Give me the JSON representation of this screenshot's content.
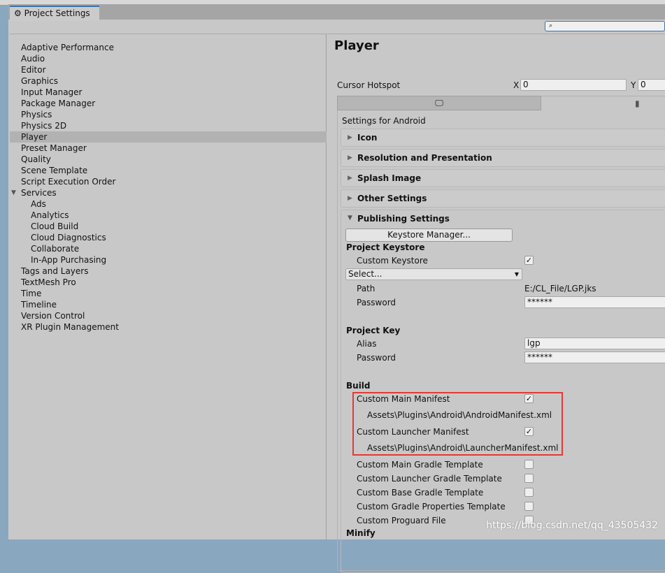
{
  "window": {
    "tab_title": "Project Settings",
    "search_placeholder": ""
  },
  "sidebar": {
    "items": [
      {
        "label": "Adaptive Performance"
      },
      {
        "label": "Audio"
      },
      {
        "label": "Editor"
      },
      {
        "label": "Graphics"
      },
      {
        "label": "Input Manager"
      },
      {
        "label": "Package Manager"
      },
      {
        "label": "Physics"
      },
      {
        "label": "Physics 2D"
      },
      {
        "label": "Player",
        "selected": true
      },
      {
        "label": "Preset Manager"
      },
      {
        "label": "Quality"
      },
      {
        "label": "Scene Template"
      },
      {
        "label": "Script Execution Order"
      },
      {
        "label": "Services",
        "expanded": true
      },
      {
        "label": "Ads",
        "sub": true
      },
      {
        "label": "Analytics",
        "sub": true
      },
      {
        "label": "Cloud Build",
        "sub": true
      },
      {
        "label": "Cloud Diagnostics",
        "sub": true
      },
      {
        "label": "Collaborate",
        "sub": true
      },
      {
        "label": "In-App Purchasing",
        "sub": true
      },
      {
        "label": "Tags and Layers"
      },
      {
        "label": "TextMesh Pro"
      },
      {
        "label": "Time"
      },
      {
        "label": "Timeline"
      },
      {
        "label": "Version Control"
      },
      {
        "label": "XR Plugin Management"
      }
    ]
  },
  "main": {
    "title": "Player",
    "cursor_hotspot": {
      "label": "Cursor Hotspot",
      "x_label": "X",
      "x": "0",
      "y_label": "Y",
      "y": "0"
    },
    "platform_tabs": [
      {
        "icon": "monitor-icon"
      },
      {
        "icon": "android-icon",
        "active": true
      }
    ],
    "settings_for": "Settings for Android",
    "sections": [
      "Icon",
      "Resolution and Presentation",
      "Splash Image",
      "Other Settings"
    ],
    "publishing": {
      "title": "Publishing Settings",
      "keystore_manager": "Keystore Manager...",
      "project_keystore": "Project Keystore",
      "custom_keystore": "Custom Keystore",
      "custom_keystore_checked": true,
      "select": "Select...",
      "path_label": "Path",
      "path": "E:/CL_File/LGP.jks",
      "password_label": "Password",
      "password": "******",
      "project_key": "Project Key",
      "alias_label": "Alias",
      "alias": "lgp",
      "key_password_label": "Password",
      "key_password": "******",
      "build": "Build",
      "build_items": [
        {
          "label": "Custom Main Manifest",
          "checked": true,
          "path": "Assets\\Plugins\\Android\\AndroidManifest.xml"
        },
        {
          "label": "Custom Launcher Manifest",
          "checked": true,
          "path": "Assets\\Plugins\\Android\\LauncherManifest.xml"
        },
        {
          "label": "Custom Main Gradle Template",
          "checked": false
        },
        {
          "label": "Custom Launcher Gradle Template",
          "checked": false
        },
        {
          "label": "Custom Base Gradle Template",
          "checked": false
        },
        {
          "label": "Custom Gradle Properties Template",
          "checked": false
        },
        {
          "label": "Custom Proguard File",
          "checked": false
        }
      ],
      "minify": "Minify"
    }
  },
  "highlight_color": "#e53935",
  "watermark": "https://blog.csdn.net/qq_43505432"
}
